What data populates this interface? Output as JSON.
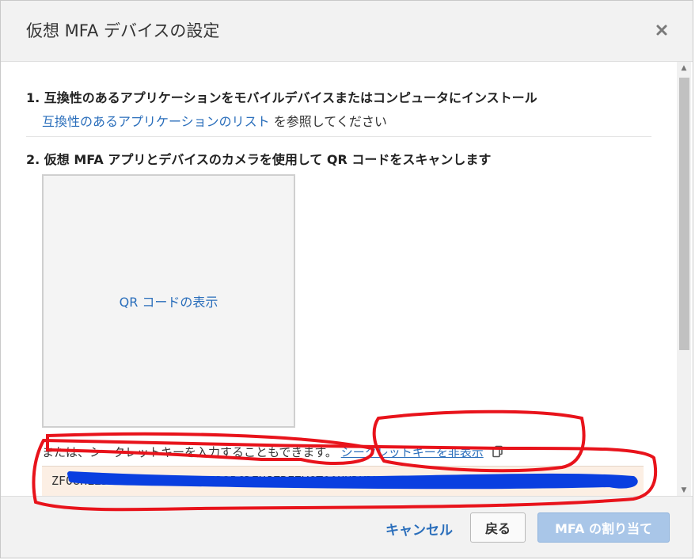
{
  "dialog": {
    "title": "仮想 MFA デバイスの設定",
    "close_icon": "close-icon"
  },
  "step1": {
    "title": "1. 互換性のあるアプリケーションをモバイルデバイスまたはコンピュータにインストール",
    "link_text": "互換性のあるアプリケーションのリスト",
    "suffix_text": " を参照してください"
  },
  "step2": {
    "title": "2. 仮想 MFA アプリとデバイスのカメラを使用して QR コードをスキャンします",
    "qr_button_label": "QR コードの表示"
  },
  "secret": {
    "prefix_text": "または、シークレットキーを入力することもできます。",
    "hide_link": "シークレットキーを非表示",
    "copy_icon": "copy-icon",
    "key_value": "ZF0UHL2DACSJFOPYIXNEAW5D3BCDEHJZBF7VGTQ0UHRKDVLDFX"
  },
  "footer": {
    "cancel_label": "キャンセル",
    "back_label": "戻る",
    "assign_label": "MFA の割り当て"
  },
  "colors": {
    "link": "#2a6ebb",
    "header_bg": "#f2f2f2",
    "secret_bg": "#fcefe4",
    "assign_disabled": "#a9c6e8",
    "annotation_red": "#e8131b",
    "redaction_blue": "#0a3fe0"
  }
}
